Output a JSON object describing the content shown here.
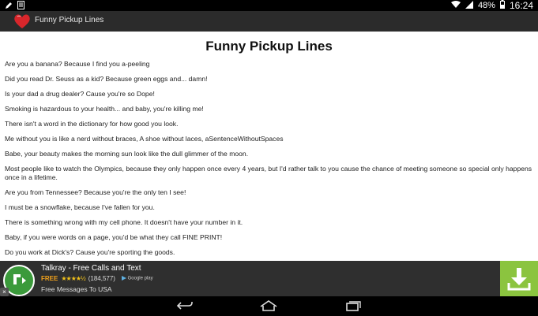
{
  "statusbar": {
    "battery": "48%",
    "time": "16:24"
  },
  "actionbar": {
    "title": "Funny Pickup Lines"
  },
  "page": {
    "heading": "Funny Pickup Lines",
    "lines": [
      "Are you a banana? Because I find you a-peeling",
      "Did you read Dr. Seuss as a kid? Because green eggs and... damn!",
      "Is your dad a drug dealer? Cause you're so Dope!",
      "Smoking is hazardous to your health... and baby, you're killing me!",
      "There isn't a word in the dictionary for how good you look.",
      "Me without you is like a nerd without braces, A shoe without laces, aSentenceWithoutSpaces",
      "Babe, your beauty makes the morning sun look like the dull glimmer of the moon.",
      "Most people like to watch the Olympics, because they only happen once every 4 years, but I'd rather talk to you cause the chance of meeting someone so special only happens once in a lifetime.",
      "Are you from Tennessee? Because you're the only ten I see!",
      "I must be a snowflake, because I've fallen for you.",
      "There is something wrong with my cell phone. It doesn't have your number in it.",
      "Baby, if you were words on a page, you'd be what they call FINE PRINT!",
      "Do you work at Dick's? Cause you're sporting the goods."
    ]
  },
  "ad": {
    "title": "Talkray - Free Calls and Text",
    "free": "FREE",
    "stars": "★★★★½",
    "rating_count": "(184,577)",
    "store": "Google play",
    "subtitle": "Free Messages To USA",
    "close": "×",
    "accent": "#8bc43f"
  }
}
